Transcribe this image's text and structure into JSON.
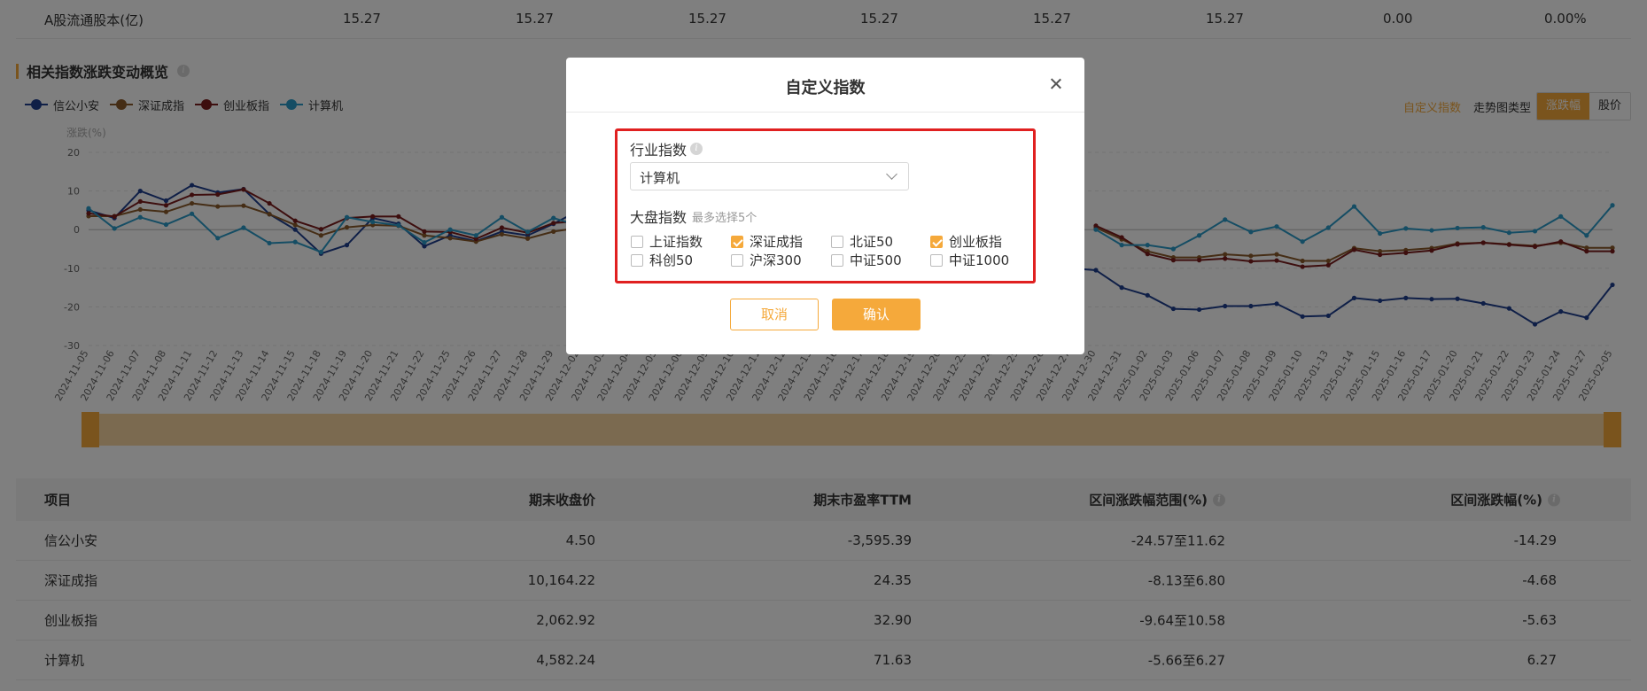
{
  "top_row": {
    "label": "A股流通股本(亿)",
    "values": [
      "15.27",
      "15.27",
      "15.27",
      "15.27",
      "15.27",
      "15.27",
      "0.00",
      "0.00%"
    ]
  },
  "section": {
    "title": "相关指数涨跌变动概览"
  },
  "controls": {
    "custom_index_link": "自定义指数",
    "trend_type_label": "走势图类型",
    "seg_change": "涨跌幅",
    "seg_price": "股价"
  },
  "colors": {
    "accent": "#f5a93b",
    "highlight_box": "#e02020"
  },
  "chart_data": {
    "type": "line",
    "ylabel": "涨跌(%)",
    "ylim": [
      -30,
      20
    ],
    "yticks": [
      20,
      10,
      0,
      -10,
      -20,
      -30
    ],
    "grid": true,
    "legend": "top-left",
    "categories": [
      "2024-11-05",
      "2024-11-06",
      "2024-11-07",
      "2024-11-08",
      "2024-11-11",
      "2024-11-12",
      "2024-11-13",
      "2024-11-14",
      "2024-11-15",
      "2024-11-18",
      "2024-11-19",
      "2024-11-20",
      "2024-11-21",
      "2024-11-22",
      "2024-11-25",
      "2024-11-26",
      "2024-11-27",
      "2024-11-28",
      "2024-11-29",
      "2024-12-02",
      "2024-12-03",
      "2024-12-04",
      "2024-12-05",
      "2024-12-06",
      "2024-12-09",
      "2024-12-10",
      "2024-12-11",
      "2024-12-12",
      "2024-12-13",
      "2024-12-16",
      "2024-12-17",
      "2024-12-18",
      "2024-12-19",
      "2024-12-20",
      "2024-12-23",
      "2024-12-24",
      "2024-12-25",
      "2024-12-26",
      "2024-12-27",
      "2024-12-30",
      "2024-12-31",
      "2025-01-02",
      "2025-01-03",
      "2025-01-06",
      "2025-01-07",
      "2025-01-08",
      "2025-01-09",
      "2025-01-10",
      "2025-01-13",
      "2025-01-14",
      "2025-01-15",
      "2025-01-16",
      "2025-01-17",
      "2025-01-20",
      "2025-01-21",
      "2025-01-22",
      "2025-01-23",
      "2025-01-24",
      "2025-01-27",
      "2025-02-05"
    ],
    "series": [
      {
        "name": "信公小安",
        "color": "#1f3f8f",
        "values": [
          5,
          3,
          10,
          7.5,
          11.5,
          9.6,
          10.5,
          4,
          0,
          -6.2,
          -4,
          3,
          1.5,
          -4.3,
          -1.5,
          -3,
          -0.5,
          -1.5,
          1.5,
          5,
          null,
          null,
          null,
          null,
          null,
          null,
          null,
          null,
          null,
          null,
          null,
          null,
          null,
          null,
          null,
          null,
          null,
          null,
          -10,
          -10.5,
          -15,
          -17,
          -20.5,
          -20.7,
          -19.8,
          -19.8,
          -19.2,
          -22.5,
          -22.3,
          -17.7,
          -18.4,
          -17.7,
          -18,
          -17.9,
          -19.1,
          -20.4,
          -24.5,
          -21.2,
          -22.8,
          -14.3
        ]
      },
      {
        "name": "深证成指",
        "color": "#8b5a2b",
        "values": [
          3.5,
          3.5,
          5.2,
          4.6,
          6.8,
          6,
          6.2,
          4,
          1.2,
          -1.5,
          0.6,
          1.2,
          1,
          -1.5,
          -2.2,
          -3.1,
          -1.2,
          -2.3,
          -0.5,
          0.5,
          null,
          null,
          null,
          null,
          null,
          null,
          null,
          null,
          null,
          null,
          null,
          null,
          null,
          null,
          null,
          null,
          null,
          null,
          null,
          0.5,
          -2.5,
          -5.6,
          -7.2,
          -7.2,
          -6.4,
          -6.8,
          -6.4,
          -8.1,
          -8.1,
          -4.8,
          -5.6,
          -5.3,
          -4.8,
          -3.6,
          -3.4,
          -3.8,
          -4.2,
          -3.4,
          -4.7,
          -4.7
        ]
      },
      {
        "name": "创业板指",
        "color": "#7a1c1c",
        "values": [
          4.2,
          3.4,
          7.3,
          6.3,
          9,
          9.1,
          10.4,
          6.8,
          2.3,
          0.1,
          3,
          3.4,
          3.4,
          -0.5,
          -0.6,
          -2.4,
          0.5,
          -0.8,
          1.7,
          2.2,
          null,
          null,
          null,
          null,
          null,
          null,
          null,
          null,
          null,
          null,
          null,
          null,
          null,
          null,
          null,
          null,
          null,
          null,
          null,
          1,
          -2,
          -6.3,
          -7.9,
          -7.9,
          -7.5,
          -8.2,
          -8,
          -9.6,
          -9.2,
          -5.2,
          -6.5,
          -6,
          -5.4,
          -3.8,
          -3.4,
          -3.9,
          -4.4,
          -3.1,
          -5.6,
          -5.6
        ]
      },
      {
        "name": "计算机",
        "color": "#2a9bc9",
        "values": [
          5.5,
          0.3,
          3.2,
          1.3,
          4.1,
          -2.2,
          0.5,
          -3.5,
          -3.2,
          -5.8,
          3.2,
          2,
          1.1,
          -3.3,
          0,
          -1.5,
          3.2,
          -0.6,
          3,
          1,
          null,
          null,
          null,
          null,
          null,
          null,
          null,
          null,
          null,
          null,
          null,
          null,
          null,
          null,
          null,
          null,
          null,
          null,
          null,
          0,
          -4,
          -4,
          -5,
          -1.5,
          2.6,
          -0.6,
          0.8,
          -3.1,
          0.5,
          6,
          -1,
          0.3,
          -0.2,
          0.4,
          0.6,
          -0.8,
          -0.4,
          3.4,
          -1.5,
          6.3
        ]
      }
    ]
  },
  "table": {
    "headers": [
      "项目",
      "期末收盘价",
      "期末市盈率TTM",
      "区间涨跌幅范围(%)",
      "区间涨跌幅(%)"
    ],
    "rows": [
      [
        "信公小安",
        "4.50",
        "-3,595.39",
        "-24.57至11.62",
        "-14.29"
      ],
      [
        "深证成指",
        "10,164.22",
        "24.35",
        "-8.13至6.80",
        "-4.68"
      ],
      [
        "创业板指",
        "2,062.92",
        "32.90",
        "-9.64至10.58",
        "-5.63"
      ],
      [
        "计算机",
        "4,582.24",
        "71.63",
        "-5.66至6.27",
        "6.27"
      ]
    ]
  },
  "modal": {
    "title": "自定义指数",
    "industry_label": "行业指数",
    "industry_value": "计算机",
    "market_label": "大盘指数",
    "market_hint": "最多选择5个",
    "options": [
      {
        "label": "上证指数",
        "checked": false
      },
      {
        "label": "深证成指",
        "checked": true
      },
      {
        "label": "北证50",
        "checked": false
      },
      {
        "label": "创业板指",
        "checked": true
      },
      {
        "label": "科创50",
        "checked": false
      },
      {
        "label": "沪深300",
        "checked": false
      },
      {
        "label": "中证500",
        "checked": false
      },
      {
        "label": "中证1000",
        "checked": false
      }
    ],
    "cancel_label": "取消",
    "confirm_label": "确认"
  }
}
